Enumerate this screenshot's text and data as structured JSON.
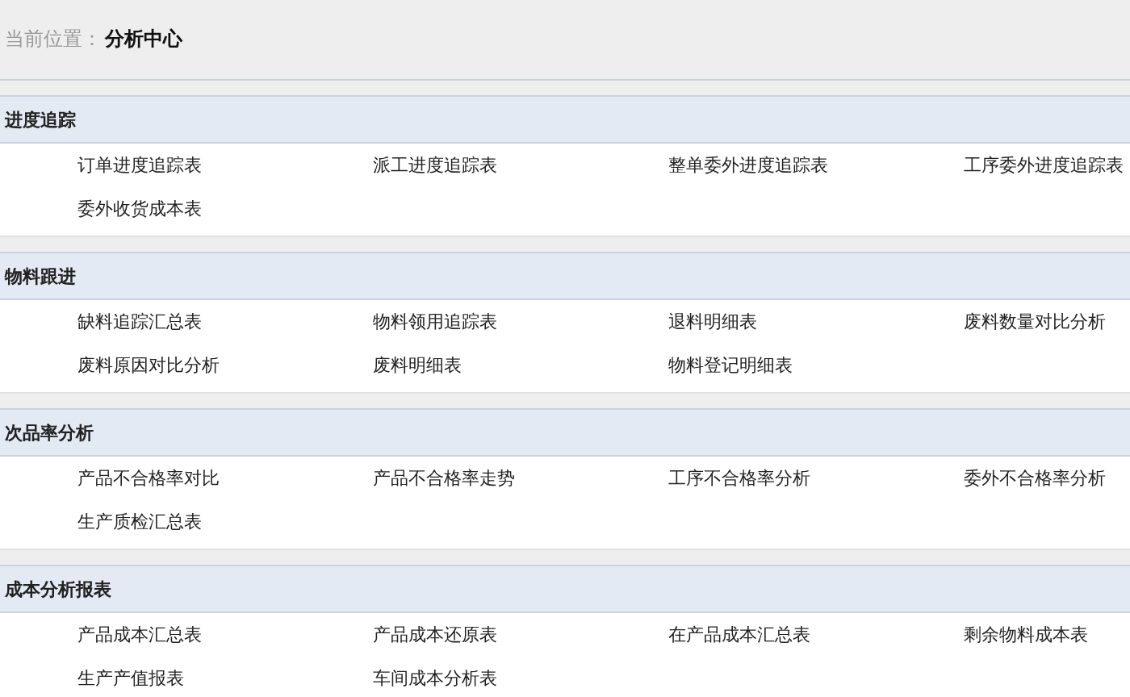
{
  "breadcrumb": {
    "label": "当前位置：",
    "current": "分析中心"
  },
  "sections": [
    {
      "title": "进度追踪",
      "items": [
        "订单进度追踪表",
        "派工进度追踪表",
        "整单委外进度追踪表",
        "工序委外进度追踪表",
        "委外收货成本表"
      ]
    },
    {
      "title": "物料跟进",
      "items": [
        "缺料追踪汇总表",
        "物料领用追踪表",
        "退料明细表",
        "废料数量对比分析",
        "废料原因对比分析",
        "废料明细表",
        "物料登记明细表"
      ]
    },
    {
      "title": "次品率分析",
      "items": [
        "产品不合格率对比",
        "产品不合格率走势",
        "工序不合格率分析",
        "委外不合格率分析",
        "生产质检汇总表"
      ]
    },
    {
      "title": "成本分析报表",
      "items": [
        "产品成本汇总表",
        "产品成本还原表",
        "在产品成本汇总表",
        "剩余物料成本表",
        "生产产值报表",
        "车间成本分析表"
      ]
    }
  ]
}
